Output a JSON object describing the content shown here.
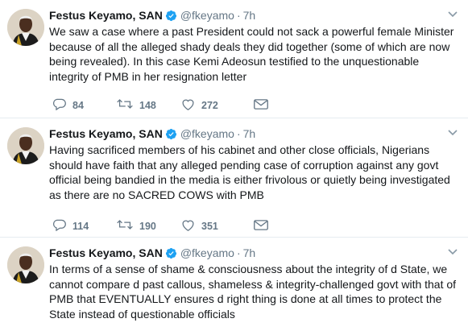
{
  "colors": {
    "text": "#14171a",
    "secondary": "#657786",
    "verified": "#1da1f2",
    "divider": "#e6ecf0"
  },
  "tweets": [
    {
      "author_name": "Festus Keyamo, SAN",
      "handle": "@fkeyamo",
      "separator": "·",
      "time": "7h",
      "text": "We saw a case where a past President could not sack a powerful female Minister because of all the alleged shady deals they did together (some of which are now being revealed). In this case Kemi Adeosun testified to the unquestionable integrity of PMB in her resignation letter",
      "replies": "84",
      "retweets": "148",
      "likes": "272"
    },
    {
      "author_name": "Festus Keyamo, SAN",
      "handle": "@fkeyamo",
      "separator": "·",
      "time": "7h",
      "text": "Having sacrificed members of his cabinet and other close officials, Nigerians should have faith that any alleged pending case of corruption against any govt official being bandied in the media is either frivolous or quietly being investigated as there are no SACRED COWS with PMB",
      "replies": "114",
      "retweets": "190",
      "likes": "351"
    },
    {
      "author_name": "Festus Keyamo, SAN",
      "handle": "@fkeyamo",
      "separator": "·",
      "time": "7h",
      "text": "In terms of a sense of shame & consciousness about the integrity of d State, we cannot compare d past callous, shameless & integrity-challenged govt with that of PMB that EVENTUALLY ensures d right thing is done at all times to protect the State instead of questionable officials"
    }
  ]
}
